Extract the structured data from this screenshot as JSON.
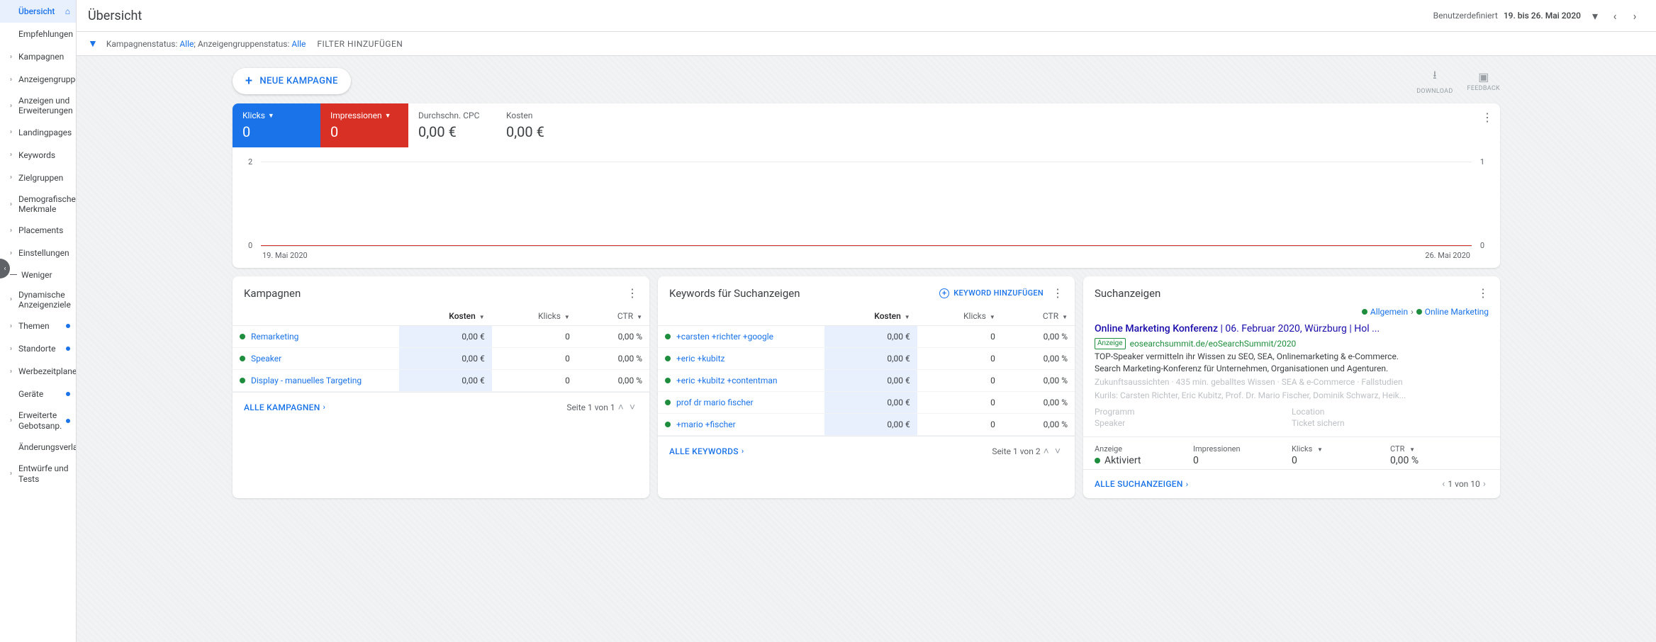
{
  "sidebar": {
    "items": [
      {
        "label": "Übersicht",
        "active": true,
        "homeIcon": true
      },
      {
        "label": "Empfehlungen"
      },
      {
        "label": "Kampagnen",
        "expandable": true
      },
      {
        "label": "Anzeigengruppen",
        "expandable": true
      },
      {
        "label": "Anzeigen und Erweiterungen",
        "expandable": true
      },
      {
        "label": "Landingpages",
        "expandable": true
      },
      {
        "label": "Keywords",
        "expandable": true
      },
      {
        "label": "Zielgruppen",
        "expandable": true
      },
      {
        "label": "Demografische Merkmale",
        "expandable": true
      },
      {
        "label": "Placements",
        "expandable": true
      },
      {
        "label": "Einstellungen",
        "expandable": true
      }
    ],
    "less": "Weniger",
    "more": [
      {
        "label": "Dynamische Anzeigenziele",
        "expandable": true,
        "dot": true
      },
      {
        "label": "Themen",
        "expandable": true,
        "dot": true
      },
      {
        "label": "Standorte",
        "expandable": true,
        "dot": true
      },
      {
        "label": "Werbezeitplaner",
        "expandable": true,
        "dot": true
      },
      {
        "label": "Geräte",
        "dot": true
      },
      {
        "label": "Erweiterte Gebotsanp.",
        "expandable": true,
        "dot": true
      },
      {
        "label": "Änderungsverlauf"
      },
      {
        "label": "Entwürfe und Tests",
        "expandable": true
      }
    ]
  },
  "header": {
    "title": "Übersicht",
    "dateLabel": "Benutzerdefiniert",
    "dateValue": "19. bis 26. Mai 2020"
  },
  "filterbar": {
    "campaignStatusLabel": "Kampagnenstatus:",
    "campaignStatusValue": "Alle",
    "adgroupStatusLabel": "Anzeigengruppenstatus:",
    "adgroupStatusValue": "Alle",
    "addFilter": "FILTER HINZUFÜGEN"
  },
  "actions": {
    "newCampaign": "NEUE KAMPAGNE",
    "download": "DOWNLOAD",
    "feedback": "FEEDBACK"
  },
  "metrics": [
    {
      "label": "Klicks",
      "value": "0",
      "style": "blue",
      "dd": true
    },
    {
      "label": "Impressionen",
      "value": "0",
      "style": "red",
      "dd": true
    },
    {
      "label": "Durchschn. CPC",
      "value": "0,00 €",
      "style": "plain"
    },
    {
      "label": "Kosten",
      "value": "0,00 €",
      "style": "plain"
    }
  ],
  "chart_data": {
    "type": "line",
    "x": [
      "19. Mai 2020",
      "26. Mai 2020"
    ],
    "series": [
      {
        "name": "Klicks",
        "values": [
          0,
          0
        ],
        "axis": "left"
      },
      {
        "name": "Impressionen",
        "values": [
          0,
          0
        ],
        "axis": "right"
      }
    ],
    "left_axis_ticks": [
      0,
      2
    ],
    "right_axis_ticks": [
      0,
      1
    ],
    "startLabel": "19. Mai 2020",
    "endLabel": "26. Mai 2020"
  },
  "campaignsCard": {
    "title": "Kampagnen",
    "cols": {
      "c1": "Kosten",
      "c2": "Klicks",
      "c3": "CTR"
    },
    "rows": [
      {
        "name": "Remarketing",
        "c1": "0,00 €",
        "c2": "0",
        "c3": "0,00 %"
      },
      {
        "name": "Speaker",
        "c1": "0,00 €",
        "c2": "0",
        "c3": "0,00 %"
      },
      {
        "name": "Display - manuelles Targeting",
        "c1": "0,00 €",
        "c2": "0",
        "c3": "0,00 %"
      }
    ],
    "footerLink": "ALLE KAMPAGNEN",
    "pager": "Seite 1 von 1"
  },
  "keywordsCard": {
    "title": "Keywords für Suchanzeigen",
    "action": "KEYWORD HINZUFÜGEN",
    "cols": {
      "c1": "Kosten",
      "c2": "Klicks",
      "c3": "CTR"
    },
    "rows": [
      {
        "name": "+carsten +richter +google",
        "c1": "0,00 €",
        "c2": "0",
        "c3": "0,00 %"
      },
      {
        "name": "+eric +kubitz",
        "c1": "0,00 €",
        "c2": "0",
        "c3": "0,00 %"
      },
      {
        "name": "+eric +kubitz +contentman",
        "c1": "0,00 €",
        "c2": "0",
        "c3": "0,00 %"
      },
      {
        "name": "prof dr mario fischer",
        "c1": "0,00 €",
        "c2": "0",
        "c3": "0,00 %"
      },
      {
        "name": "+mario +fischer",
        "c1": "0,00 €",
        "c2": "0",
        "c3": "0,00 %"
      }
    ],
    "footerLink": "ALLE KEYWORDS",
    "pager": "Seite 1 von 2"
  },
  "adsCard": {
    "title": "Suchanzeigen",
    "breadcrumb": {
      "a": "Allgemein",
      "b": "Online Marketing"
    },
    "ad": {
      "titleBold": "Online Marketing Konferenz",
      "titleRest": " | 06. Februar 2020, Würzburg | Hol ...",
      "badge": "Anzeige",
      "url": "eosearchsummit.de/eoSearchSummit/2020",
      "desc1": "TOP-Speaker vermitteln ihr Wissen zu SEO, SEA, Onlinemarketing & e-Commerce.",
      "desc2": "Search Marketing-Konferenz für Unternehmen, Organisationen und Agenturen.",
      "sub1": "Zukunftsaussichten · 435 min. geballtes Wissen · SEA & e-Commerce · Fallstudien",
      "sub2": "Kurils: Carsten Richter, Eric Kubitz, Prof. Dr. Mario Fischer, Dominik Schwarz, Heik...",
      "sl1": "Programm",
      "sl2": "Location",
      "sl3": "Speaker",
      "sl4": "Ticket sichern"
    },
    "stats": {
      "s1l": "Anzeige",
      "s1v": "Aktiviert",
      "s2l": "Impressionen",
      "s2v": "0",
      "s3l": "Klicks",
      "s3v": "0",
      "s4l": "CTR",
      "s4v": "0,00 %"
    },
    "footerLink": "ALLE SUCHANZEIGEN",
    "pager": "1 von 10"
  }
}
